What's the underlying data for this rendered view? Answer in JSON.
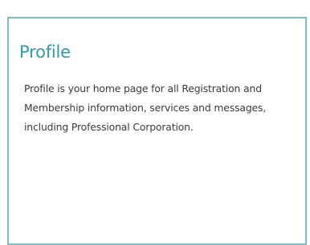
{
  "profile_card": {
    "title": "Profile",
    "description": "Profile is your home page for all Registration and Membership information, services and messages, including Professional Corporation."
  },
  "colors": {
    "accent": "#2f9ea4",
    "border": "#7fbfc3",
    "body_text": "#3a3a3a"
  }
}
